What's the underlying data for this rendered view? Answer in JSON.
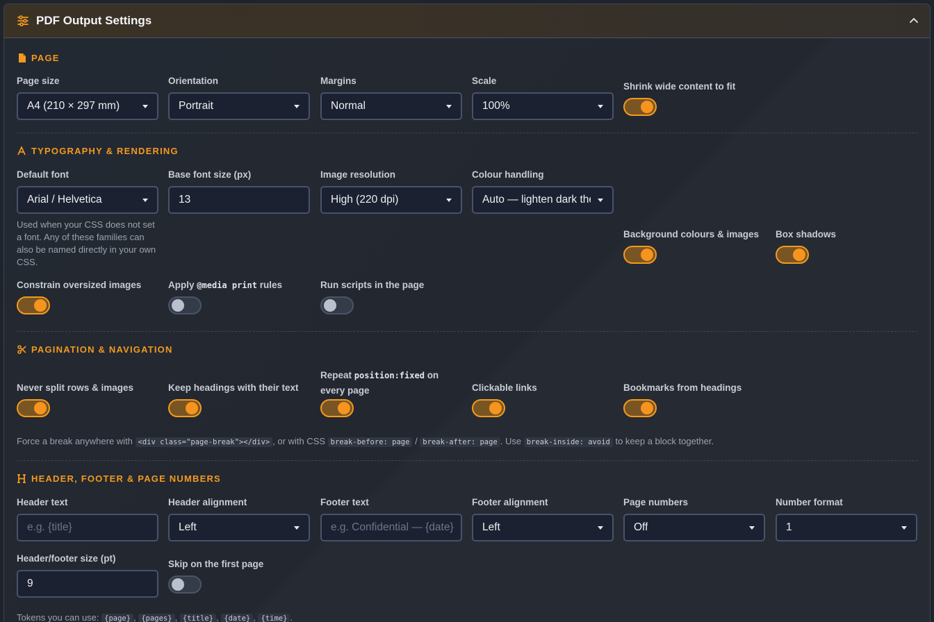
{
  "header": {
    "title": "PDF Output Settings",
    "collapse_icon": "chevron-up-icon"
  },
  "page": {
    "section_title": "PAGE",
    "page_size": {
      "label": "Page size",
      "value": "A4 (210 × 297 mm)"
    },
    "orientation": {
      "label": "Orientation",
      "value": "Portrait"
    },
    "margins": {
      "label": "Margins",
      "value": "Normal"
    },
    "scale": {
      "label": "Scale",
      "value": "100%"
    },
    "shrink": {
      "label": "Shrink wide content to fit",
      "on": true
    }
  },
  "typography": {
    "section_title": "TYPOGRAPHY & RENDERING",
    "default_font": {
      "label": "Default font",
      "value": "Arial / Helvetica",
      "help": "Used when your CSS does not set a font. Any of these families can also be named directly in your own CSS."
    },
    "base_font_size": {
      "label": "Base font size (px)",
      "value": "13"
    },
    "image_resolution": {
      "label": "Image resolution",
      "value": "High (220 dpi)"
    },
    "colour_handling": {
      "label": "Colour handling",
      "value": "Auto — lighten dark themes"
    },
    "background": {
      "label": "Background colours & images",
      "on": true
    },
    "box_shadows": {
      "label": "Box shadows",
      "on": true
    },
    "constrain_images": {
      "label": "Constrain oversized images",
      "on": true
    },
    "media_print": {
      "label_prefix": "Apply ",
      "label_code": "@media print",
      "label_suffix": " rules",
      "on": false
    },
    "run_scripts": {
      "label": "Run scripts in the page",
      "on": false
    }
  },
  "pagination": {
    "section_title": "PAGINATION & NAVIGATION",
    "never_split": {
      "label": "Never split rows & images",
      "on": true
    },
    "keep_headings": {
      "label": "Keep headings with their text",
      "on": true
    },
    "repeat_fixed": {
      "label_prefix": "Repeat ",
      "label_code": "position:fixed",
      "label_suffix": " on",
      "label_line2": "every page",
      "on": true
    },
    "clickable_links": {
      "label": "Clickable links",
      "on": true
    },
    "bookmarks": {
      "label": "Bookmarks from headings",
      "on": true
    },
    "help": {
      "t1": "Force a break anywhere with ",
      "c1": "<div class=\"page-break\"></div>",
      "t2": ", or with CSS ",
      "c2": "break-before: page",
      "t3": " / ",
      "c3": "break-after: page",
      "t4": ". Use ",
      "c4": "break-inside: avoid",
      "t5": " to keep a block together."
    }
  },
  "header_footer": {
    "section_title": "HEADER, FOOTER & PAGE NUMBERS",
    "header_text": {
      "label": "Header text",
      "placeholder": "e.g. {title}"
    },
    "header_alignment": {
      "label": "Header alignment",
      "value": "Left"
    },
    "footer_text": {
      "label": "Footer text",
      "placeholder": "e.g. Confidential — {date}"
    },
    "footer_alignment": {
      "label": "Footer alignment",
      "value": "Left"
    },
    "page_numbers": {
      "label": "Page numbers",
      "value": "Off"
    },
    "number_format": {
      "label": "Number format",
      "value": "1"
    },
    "hf_size": {
      "label": "Header/footer size (pt)",
      "value": "9"
    },
    "skip_first": {
      "label": "Skip on the first page",
      "on": false
    },
    "tokens": {
      "prefix": "Tokens you can use: ",
      "list": [
        "{page}",
        "{pages}",
        "{title}",
        "{date}",
        "{time}"
      ],
      "sep": ", ",
      "end": "."
    }
  },
  "colors": {
    "accent": "#f39a1e",
    "background": "#1f242c",
    "field_bg": "#1b2130"
  }
}
